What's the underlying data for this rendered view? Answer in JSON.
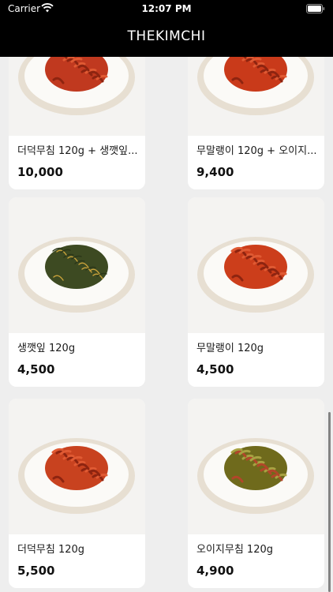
{
  "status_bar": {
    "carrier": "Carrier",
    "time": "12:07 PM"
  },
  "header": {
    "title": "THEKIMCHI"
  },
  "products": [
    {
      "title": "더덕무침 120g + 생깻잎...",
      "price": "10,000",
      "dish_color": "#c0391f",
      "food": "deodeok"
    },
    {
      "title": "무말랭이 120g + 오이지...",
      "price": "9,400",
      "dish_color": "#c93a1a",
      "food": "radish"
    },
    {
      "title": "생깻잎 120g",
      "price": "4,500",
      "dish_color": "#3d4a22",
      "food": "perilla"
    },
    {
      "title": "무말랭이 120g",
      "price": "4,500",
      "dish_color": "#cc3e1b",
      "food": "radish"
    },
    {
      "title": "더덕무침 120g",
      "price": "5,500",
      "dish_color": "#c8421f",
      "food": "deodeok"
    },
    {
      "title": "오이지무침 120g",
      "price": "4,900",
      "dish_color": "#6f6a1c",
      "food": "cucumber"
    }
  ],
  "colors": {
    "background": "#eeeeee",
    "header": "#000000",
    "card": "#ffffff"
  }
}
